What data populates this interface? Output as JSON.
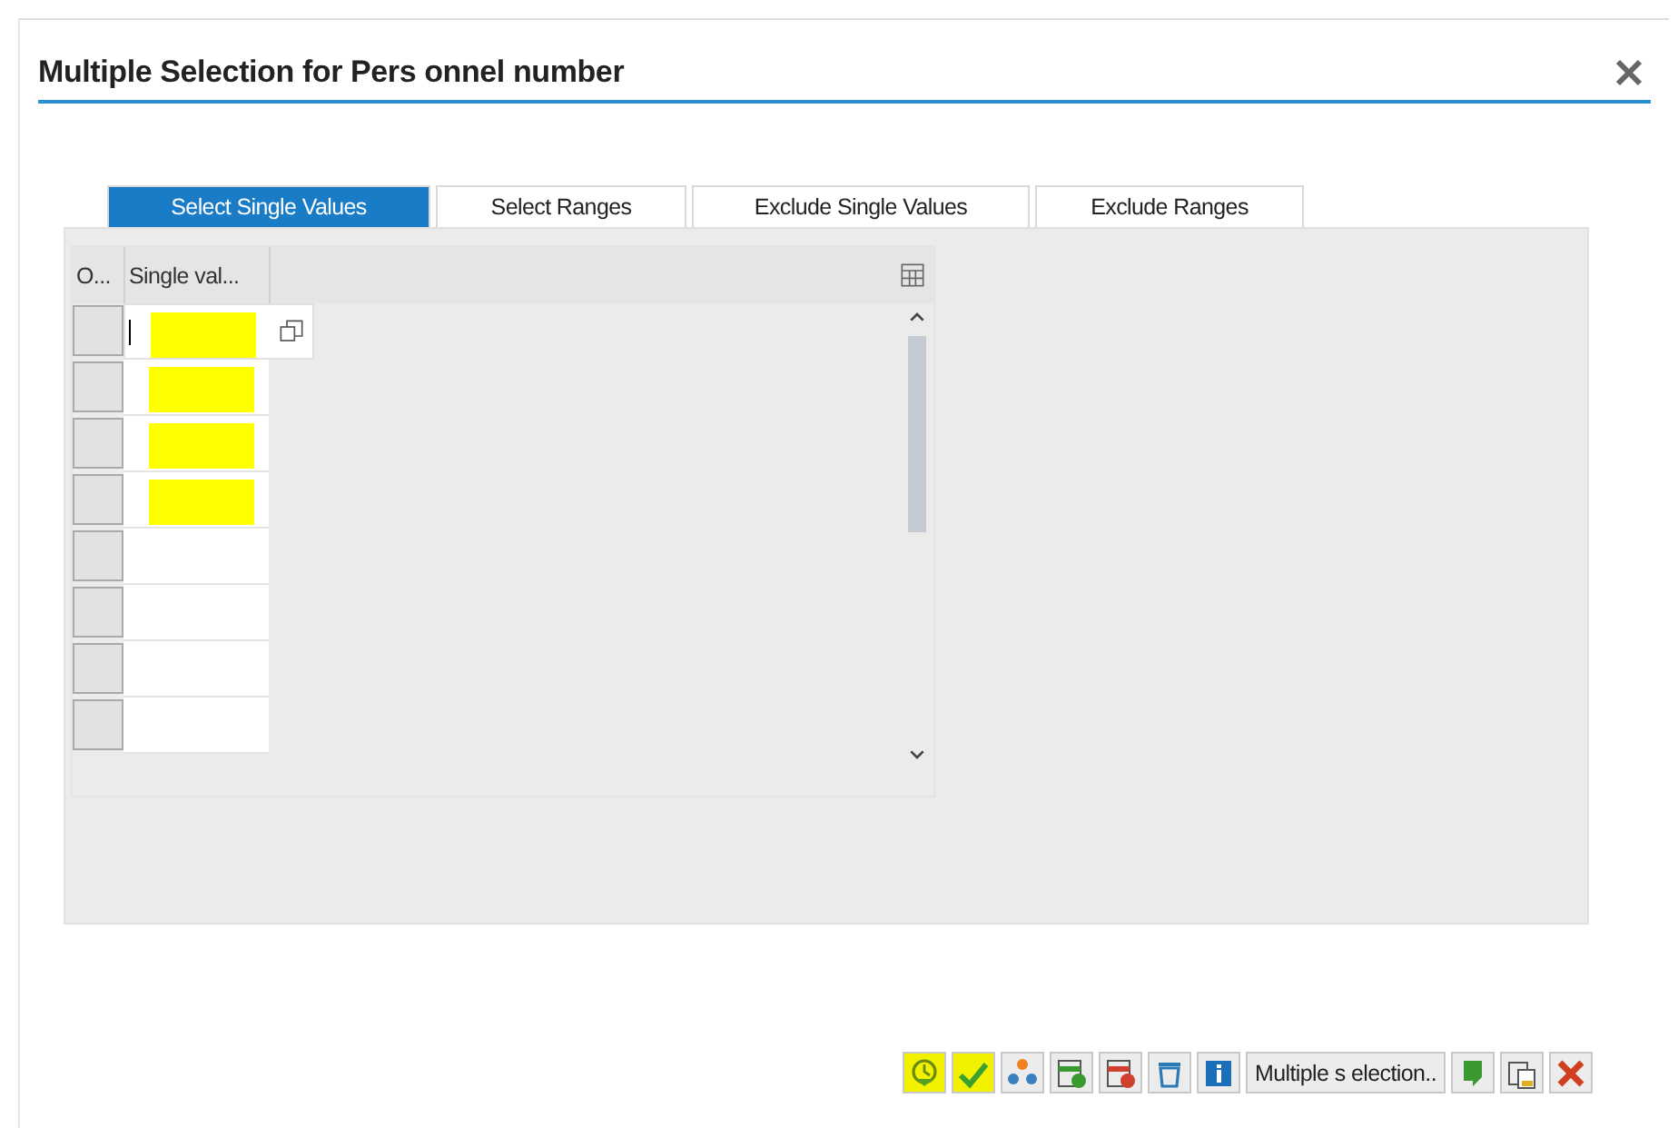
{
  "dialog": {
    "title": "Multiple Selection for Pers onnel number"
  },
  "tabs": [
    {
      "label": "Select Single Values",
      "selected": true
    },
    {
      "label": "Select Ranges",
      "selected": false
    },
    {
      "label": "Exclude Single Values",
      "selected": false
    },
    {
      "label": "Exclude Ranges",
      "selected": false
    }
  ],
  "table": {
    "columns": [
      "O...",
      "Single val..."
    ],
    "rows": [
      {
        "redacted": true,
        "focused": true
      },
      {
        "redacted": true,
        "focused": false
      },
      {
        "redacted": true,
        "focused": false
      },
      {
        "redacted": true,
        "focused": false
      },
      {
        "redacted": false,
        "focused": false
      },
      {
        "redacted": false,
        "focused": false
      },
      {
        "redacted": false,
        "focused": false
      },
      {
        "redacted": false,
        "focused": false
      }
    ]
  },
  "toolbar": [
    {
      "kind": "execute",
      "highlighted": true
    },
    {
      "kind": "check",
      "highlighted": true
    },
    {
      "kind": "options",
      "highlighted": false
    },
    {
      "kind": "insert-row",
      "highlighted": false
    },
    {
      "kind": "delete-row",
      "highlighted": false
    },
    {
      "kind": "trash",
      "highlighted": false
    },
    {
      "kind": "info",
      "highlighted": false
    },
    {
      "kind": "text",
      "label": "Multiple s election..",
      "highlighted": false
    },
    {
      "kind": "import",
      "highlighted": false
    },
    {
      "kind": "paste",
      "highlighted": false
    },
    {
      "kind": "cancel",
      "highlighted": false
    }
  ]
}
